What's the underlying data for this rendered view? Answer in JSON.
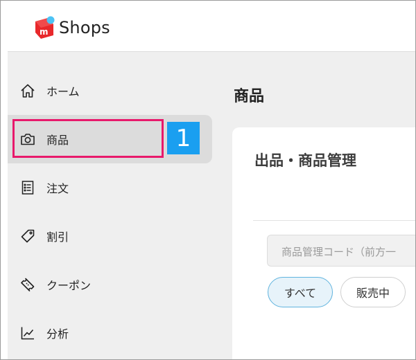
{
  "header": {
    "logo_text": "Shops",
    "logo_badge": "m",
    "colors": {
      "logo_red": "#e8282b",
      "logo_dot": "#4cc3f5"
    }
  },
  "sidebar": {
    "items": [
      {
        "label": "ホーム",
        "icon": "home-icon"
      },
      {
        "label": "商品",
        "icon": "camera-icon",
        "active": true
      },
      {
        "label": "注文",
        "icon": "order-list-icon"
      },
      {
        "label": "割引",
        "icon": "price-tag-icon"
      },
      {
        "label": "クーポン",
        "icon": "coupon-ticket-icon"
      },
      {
        "label": "分析",
        "icon": "analytics-chart-icon"
      }
    ]
  },
  "annotation": {
    "step_number": "1",
    "colors": {
      "highlight": "#e8196b",
      "badge": "#1a9ff0"
    }
  },
  "main": {
    "page_title": "商品",
    "card_title": "出品・商品管理",
    "search": {
      "placeholder": "商品管理コード（前方一"
    },
    "filters": [
      {
        "label": "すべて",
        "selected": true
      },
      {
        "label": "販売中",
        "selected": false
      }
    ]
  }
}
